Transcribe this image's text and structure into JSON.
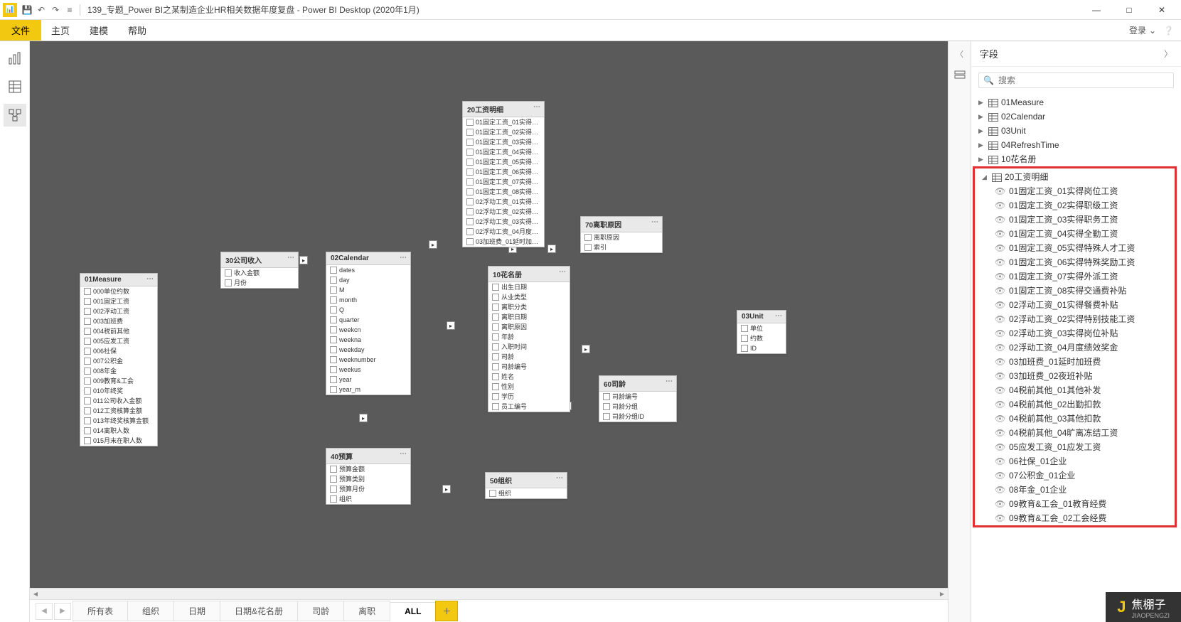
{
  "titlebar": {
    "doc_title": "139_专题_Power BI之某制造企业HR相关数据年度复盘 - Power BI Desktop (2020年1月)"
  },
  "window_controls": {
    "min": "—",
    "max": "□",
    "close": "✕"
  },
  "ribbon": {
    "file": "文件",
    "tabs": [
      "主页",
      "建模",
      "帮助"
    ],
    "login": "登录"
  },
  "fields_panel": {
    "title": "字段",
    "search_placeholder": "搜索",
    "tables": [
      {
        "name": "01Measure",
        "expanded": false
      },
      {
        "name": "02Calendar",
        "expanded": false
      },
      {
        "name": "03Unit",
        "expanded": false
      },
      {
        "name": "04RefreshTime",
        "expanded": false
      },
      {
        "name": "10花名册",
        "expanded": false
      }
    ],
    "expanded_table": {
      "name": "20工资明细",
      "fields": [
        "01固定工资_01实得岗位工资",
        "01固定工资_02实得职级工资",
        "01固定工资_03实得职务工资",
        "01固定工资_04实得全勤工资",
        "01固定工资_05实得特殊人才工资",
        "01固定工资_06实得特殊奖励工资",
        "01固定工资_07实得外派工资",
        "01固定工资_08实得交通费补贴",
        "02浮动工资_01实得餐费补贴",
        "02浮动工资_02实得特别技能工资",
        "02浮动工资_03实得岗位补贴",
        "02浮动工资_04月度绩效奖金",
        "03加班费_01延时加班费",
        "03加班费_02夜班补贴",
        "04税前其他_01其他补发",
        "04税前其他_02出勤扣款",
        "04税前其他_03其他扣款",
        "04税前其他_04旷离冻结工资",
        "05应发工资_01应发工资",
        "06社保_01企业",
        "07公积金_01企业",
        "08年金_01企业",
        "09教育&工会_01教育经费",
        "09教育&工会_02工会经费"
      ]
    }
  },
  "canvas_tables": {
    "t01": {
      "title": "01Measure",
      "fields": [
        "000单位约数",
        "001固定工资",
        "002浮动工资",
        "003加班费",
        "004税前其他",
        "005应发工资",
        "006社保",
        "007公积金",
        "008年金",
        "009教育&工会",
        "010年终奖",
        "011公司收入金额",
        "012工资核算金额",
        "013年终奖核算金额",
        "014离职人数",
        "015月末在职人数"
      ]
    },
    "t30": {
      "title": "30公司收入",
      "fields": [
        "收入金额",
        "月份"
      ]
    },
    "t02": {
      "title": "02Calendar",
      "fields": [
        "dates",
        "day",
        "M",
        "month",
        "Q",
        "quarter",
        "weekcn",
        "weekna",
        "weekday",
        "weeknumber",
        "weekus",
        "year",
        "year_m"
      ]
    },
    "t20": {
      "title": "20工资明细",
      "fields": [
        "01固定工资_01实得岗位...",
        "01固定工资_02实得职级...",
        "01固定工资_03实得职务...",
        "01固定工资_04实得全勤...",
        "01固定工资_05实得特殊...",
        "01固定工资_06实得特殊...",
        "01固定工资_07实得外派...",
        "01固定工资_08实得交通...",
        "02浮动工资_01实得餐费...",
        "02浮动工资_02实得特别...",
        "02浮动工资_03实得岗位...",
        "02浮动工资_04月度绩效...",
        "03加班费_01延时加班费"
      ]
    },
    "t10": {
      "title": "10花名册",
      "fields": [
        "出生日期",
        "从业类型",
        "离职分类",
        "离职日期",
        "离职原因",
        "年龄",
        "入职时间",
        "司龄",
        "司龄编号",
        "姓名",
        "性别",
        "学历",
        "员工编号"
      ]
    },
    "t70": {
      "title": "70离职原因",
      "fields": [
        "离职原因",
        "索引"
      ]
    },
    "t03": {
      "title": "03Unit",
      "fields": [
        "单位",
        "约数",
        "ID"
      ]
    },
    "t60": {
      "title": "60司龄",
      "fields": [
        "司龄编号",
        "司龄分组",
        "司龄分组ID"
      ]
    },
    "t40": {
      "title": "40预算",
      "fields": [
        "预算金额",
        "预算类别",
        "预算月份",
        "组织"
      ]
    },
    "t50": {
      "title": "50组织",
      "fields": [
        "组织"
      ]
    }
  },
  "bottom_tabs": {
    "pages": [
      "所有表",
      "组织",
      "日期",
      "日期&花名册",
      "司龄",
      "离职",
      "ALL"
    ],
    "active": "ALL"
  },
  "watermark": {
    "name": "焦棚子",
    "sub": "JIAOPENGZI"
  }
}
